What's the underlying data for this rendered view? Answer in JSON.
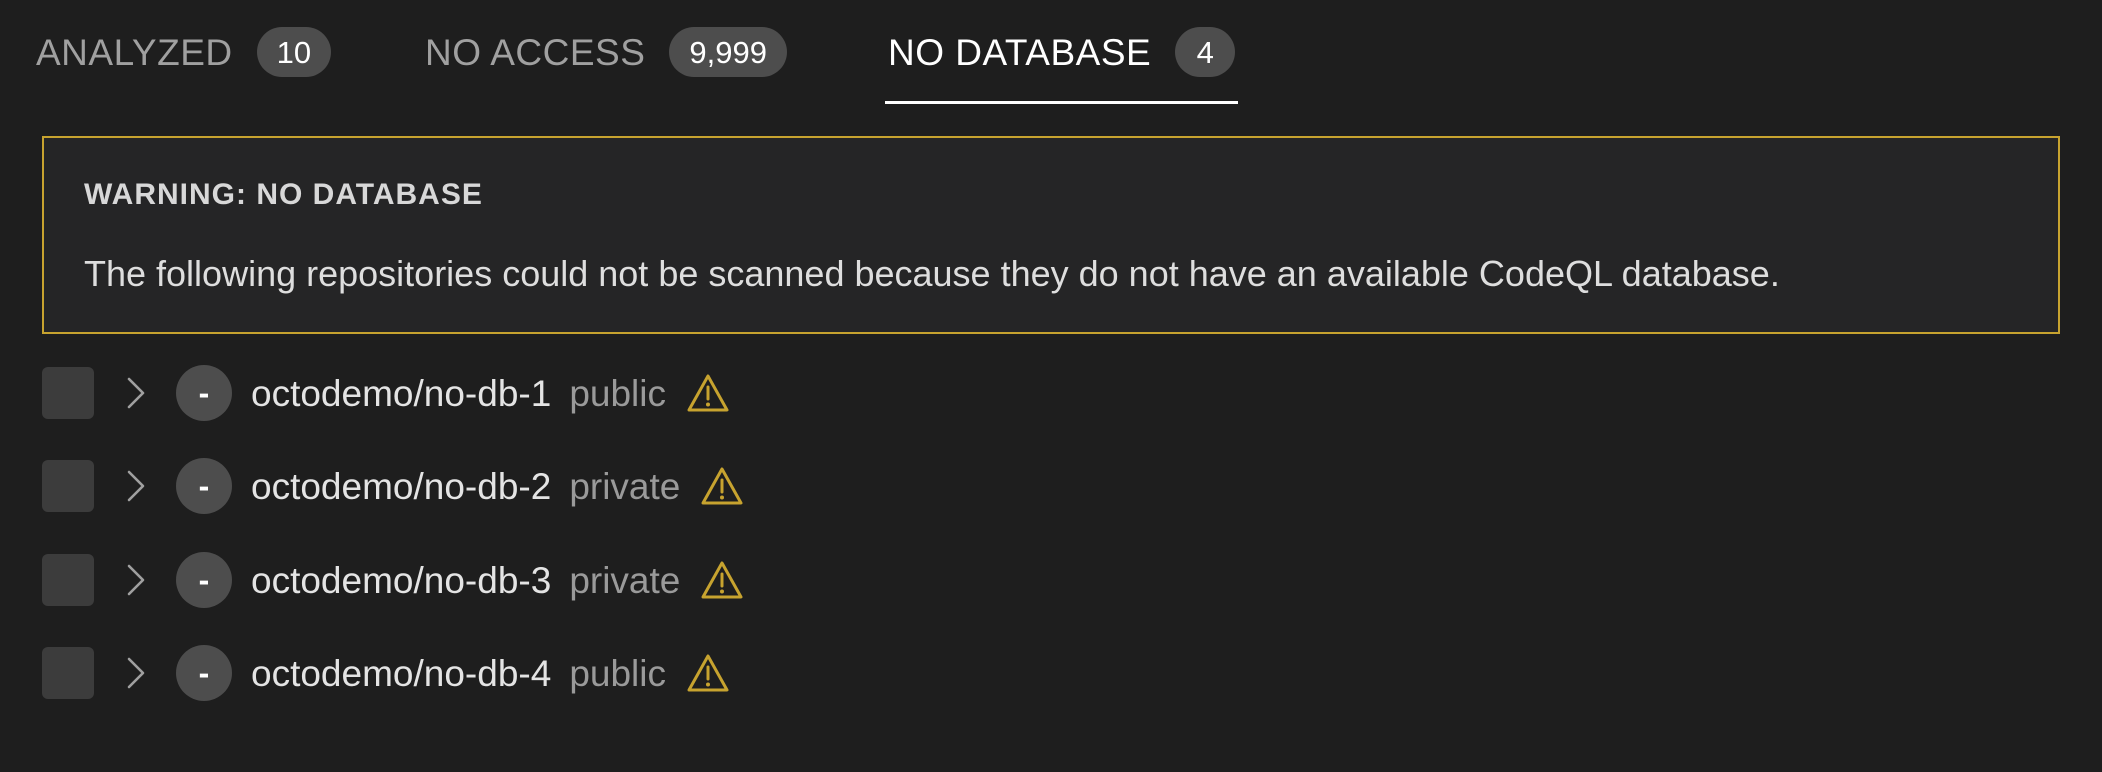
{
  "tabs": [
    {
      "label": "ANALYZED",
      "count": "10",
      "active": false
    },
    {
      "label": "NO ACCESS",
      "count": "9,999",
      "active": false
    },
    {
      "label": "NO DATABASE",
      "count": "4",
      "active": true
    }
  ],
  "warning": {
    "title": "WARNING: NO DATABASE",
    "message": "The following repositories could not be scanned because they do not have an available CodeQL database."
  },
  "repos": [
    {
      "name": "octodemo/no-db-1",
      "visibility": "public",
      "status": "-"
    },
    {
      "name": "octodemo/no-db-2",
      "visibility": "private",
      "status": "-"
    },
    {
      "name": "octodemo/no-db-3",
      "visibility": "private",
      "status": "-"
    },
    {
      "name": "octodemo/no-db-4",
      "visibility": "public",
      "status": "-"
    }
  ],
  "icons": {
    "chevron": "chevron-right-icon",
    "warning": "warning-triangle-icon"
  },
  "colors": {
    "background": "#1e1e1e",
    "warning_accent": "#c7a32f",
    "badge": "#4d4d4d",
    "active_tab": "#ffffff",
    "inactive_tab": "#a0a0a0"
  }
}
